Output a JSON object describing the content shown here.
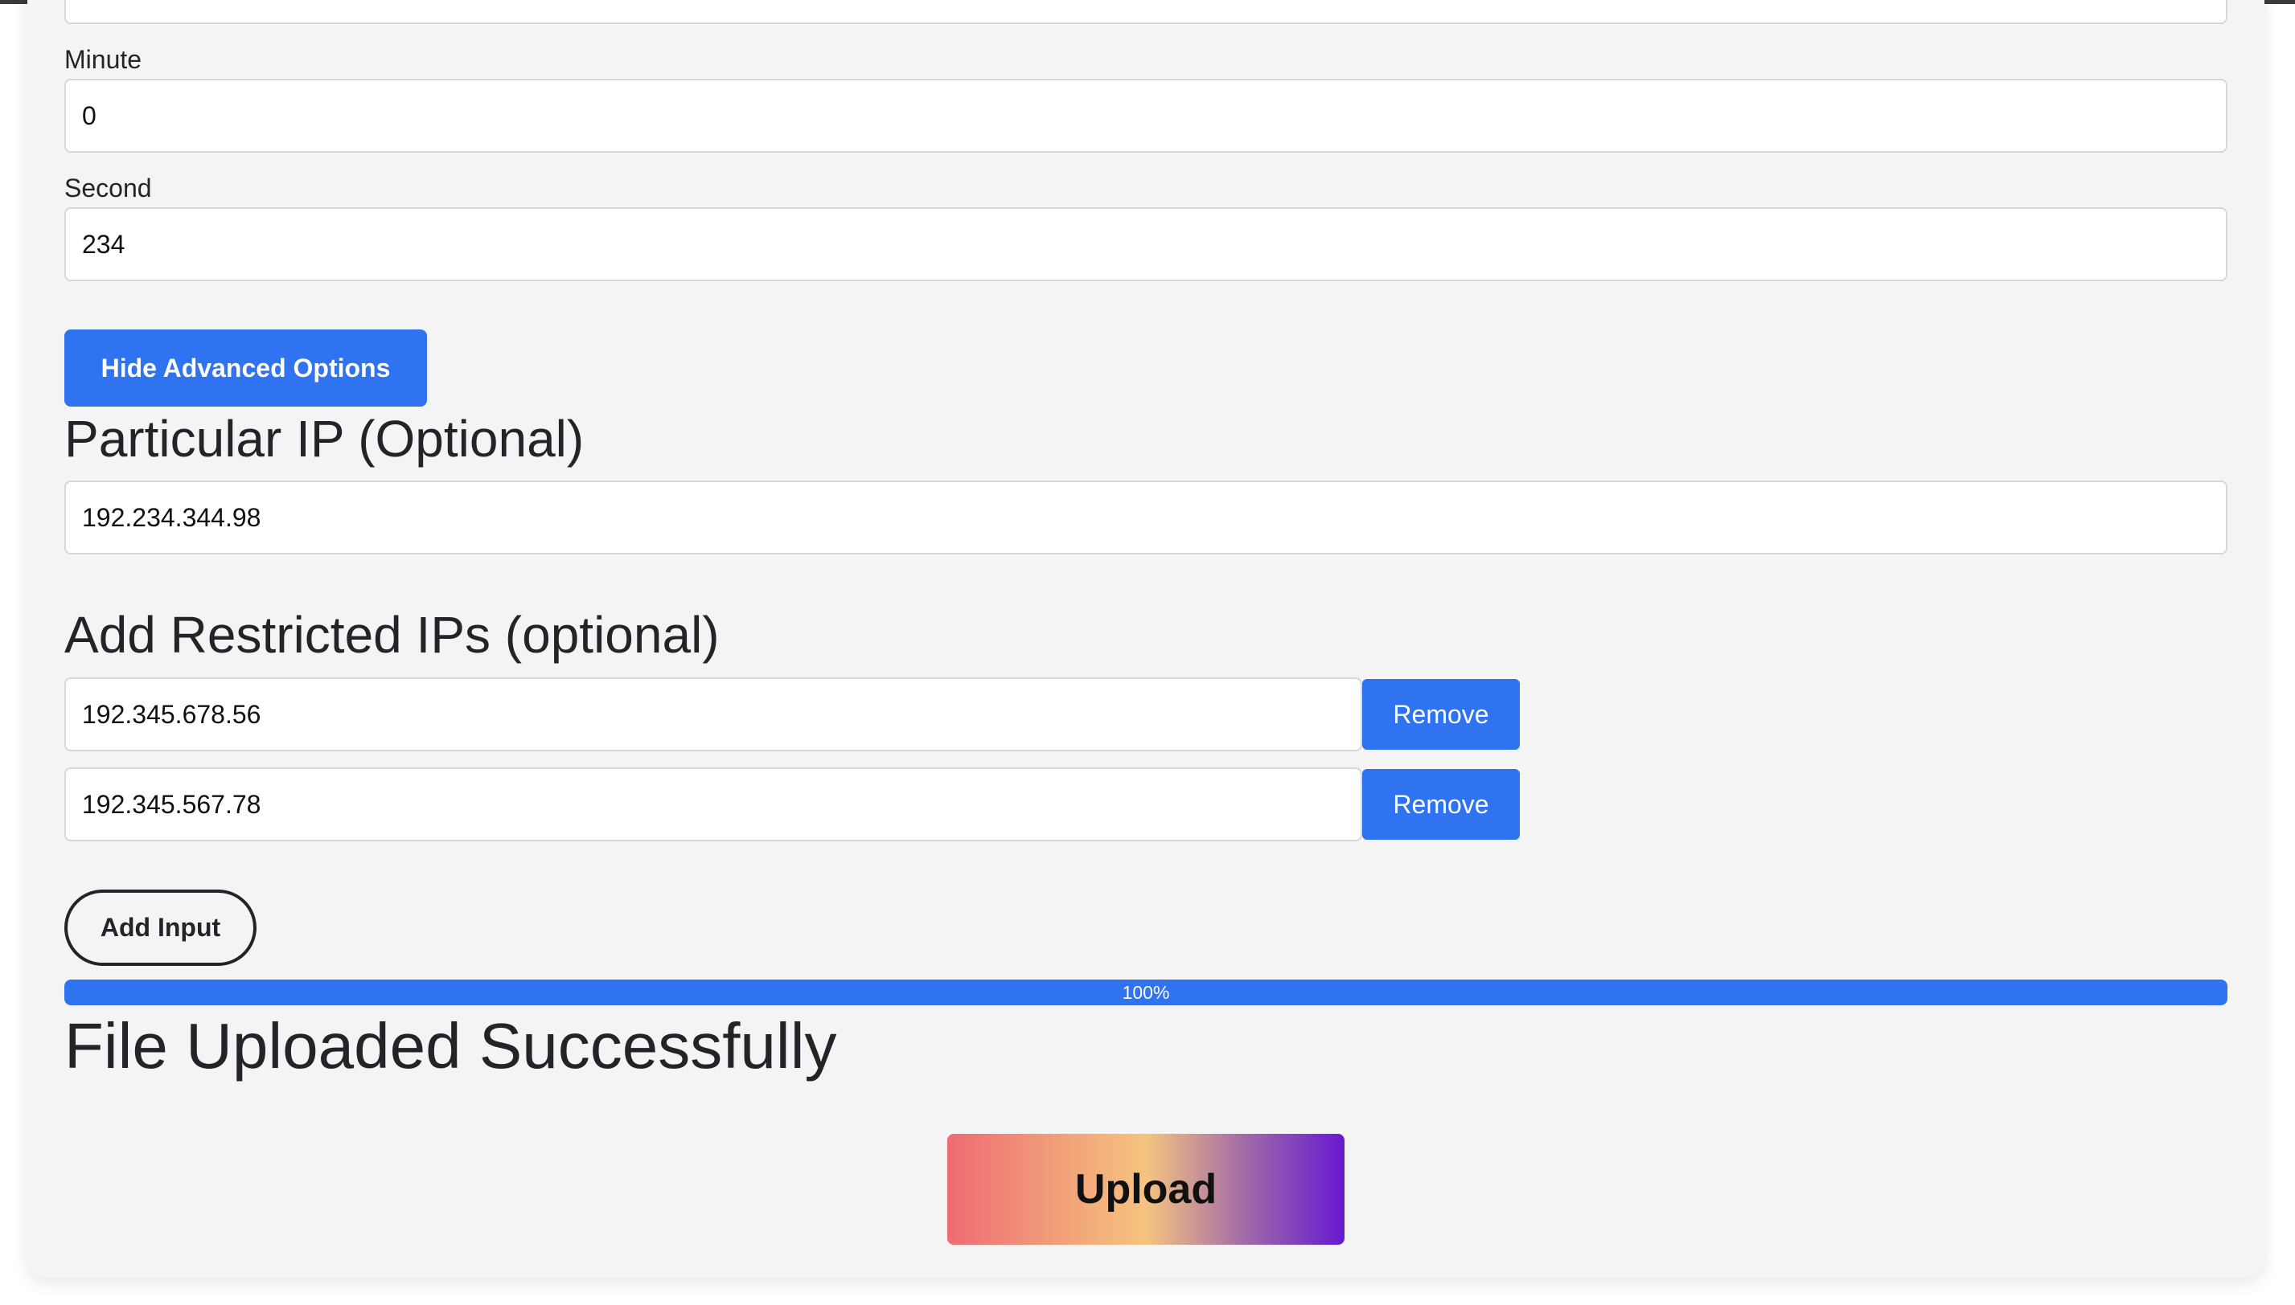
{
  "form": {
    "minute": {
      "label": "Minute",
      "value": "0"
    },
    "second": {
      "label": "Second",
      "value": "234"
    },
    "advanced_toggle_label": "Hide Advanced Options",
    "particular_ip": {
      "heading": "Particular IP (Optional)",
      "value": "192.234.344.98"
    },
    "restricted_ips": {
      "heading": "Add Restricted IPs (optional)",
      "items": [
        {
          "value": "192.345.678.56",
          "remove_label": "Remove"
        },
        {
          "value": "192.345.567.78",
          "remove_label": "Remove"
        }
      ],
      "add_label": "Add Input"
    }
  },
  "progress": {
    "value": 100,
    "label": "100%"
  },
  "status": {
    "message": "File Uploaded Successfully"
  },
  "upload": {
    "label": "Upload"
  },
  "colors": {
    "primary": "#3073f0",
    "card_background": "#f4f4f4",
    "text": "#222429",
    "upload_gradient": [
      "#ee6b73",
      "#f5c47f",
      "#6619d0"
    ]
  }
}
